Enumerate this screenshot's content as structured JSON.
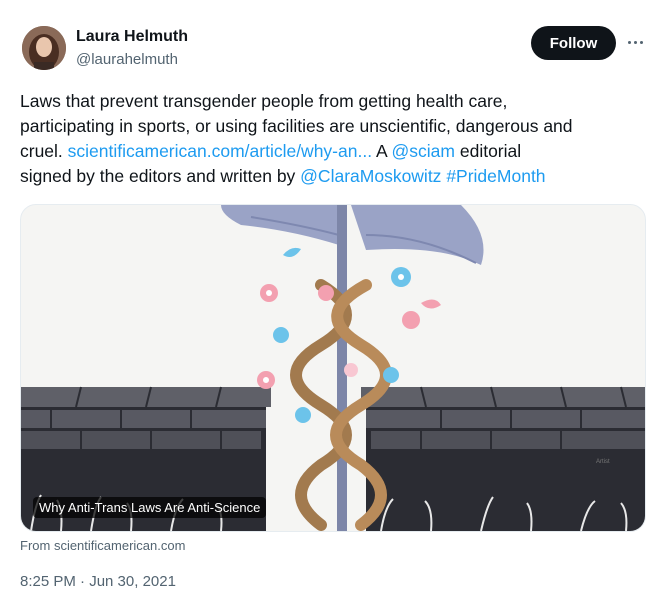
{
  "author": {
    "name": "Laura Helmuth",
    "handle": "@laurahelmuth"
  },
  "follow_label": "Follow",
  "tweet": {
    "line1": "Laws that prevent transgender people from getting health care,",
    "line2": "participating in sports, or using facilities are unscientific, dangerous and",
    "line3_start": "cruel. ",
    "link": "scientificamerican.com/article/why-an...",
    "mid": " A ",
    "mention_sciam": "@sciam",
    "line3_end": " editorial",
    "line4_start": "signed by the editors and written by ",
    "mention_clara": "@ClaraMoskowitz",
    "space": " ",
    "hashtag": "#PrideMonth"
  },
  "card": {
    "title": "Why Anti-Trans Laws Are Anti-Science",
    "source": "From scientificamerican.com",
    "illustration_icon": "caduceus-icon"
  },
  "timestamp": "8:25 PM · Jun 30, 2021",
  "colors": {
    "link": "#1d9bf0",
    "follow_bg": "#0f1419",
    "muted": "#536471"
  }
}
